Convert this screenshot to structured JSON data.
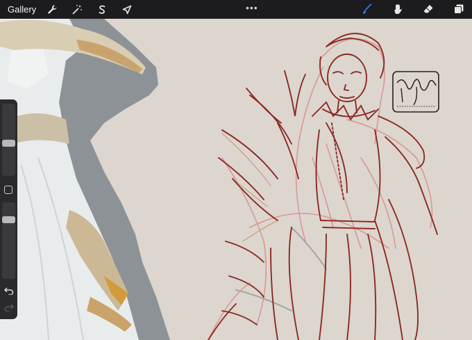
{
  "toolbar": {
    "gallery_label": "Gallery",
    "more_label": "•••",
    "left_icons": [
      "wrench-icon",
      "magic-wand-icon",
      "selection-s-icon",
      "transform-arrow-icon"
    ],
    "right_icons": [
      "brush-icon",
      "smudge-icon",
      "eraser-icon",
      "layers-icon"
    ],
    "active_color": "#2f7ff7"
  },
  "sidebar": {
    "brush_size_level": 0.45,
    "opacity_level": 0.4
  },
  "colors": {
    "toolbar_bg": "#1c1c1e",
    "canvas_bg": "#dcd6cf",
    "sketch_dark": "#8b2a22",
    "sketch_light": "#d89890"
  }
}
